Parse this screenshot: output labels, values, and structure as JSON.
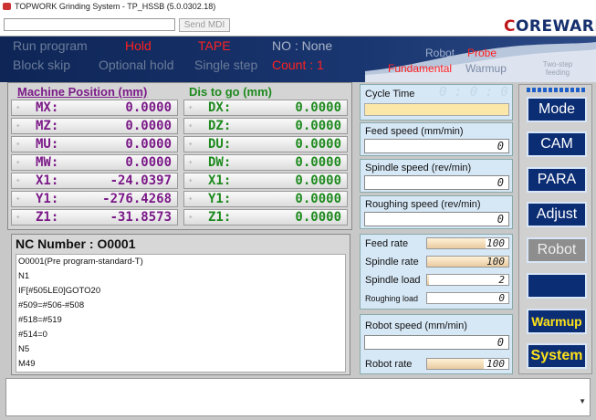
{
  "window": {
    "title": "TOPWORK Grinding System - TP_HSSB (5.0.0302.18)"
  },
  "toolbar": {
    "mdi_value": "",
    "send_mdi": "Send MDI",
    "logo_prefix": "C",
    "logo_rest": "OREWARE"
  },
  "status": {
    "run_program": "Run program",
    "hold": "Hold",
    "tape": "TAPE",
    "no": "NO : None",
    "block_skip": "Block skip",
    "optional_hold": "Optional hold",
    "single_step": "Single step",
    "count": "Count : 1",
    "robot": "Robot",
    "probe": "Probe",
    "fundamental": "Fundamental",
    "warmup": "Warmup",
    "two_step": "Two-step feeding"
  },
  "machine": {
    "title": "Machine Position (mm)",
    "dis_title": "Dis to go  (mm)",
    "left": [
      {
        "name": "MX:",
        "value": "0.0000"
      },
      {
        "name": "MZ:",
        "value": "0.0000"
      },
      {
        "name": "MU:",
        "value": "0.0000"
      },
      {
        "name": "MW:",
        "value": "0.0000"
      },
      {
        "name": "X1:",
        "value": "-24.0397"
      },
      {
        "name": "Y1:",
        "value": "-276.4268"
      },
      {
        "name": "Z1:",
        "value": "-31.8573"
      }
    ],
    "right": [
      {
        "name": "DX:",
        "value": "0.0000"
      },
      {
        "name": "DZ:",
        "value": "0.0000"
      },
      {
        "name": "DU:",
        "value": "0.0000"
      },
      {
        "name": "DW:",
        "value": "0.0000"
      },
      {
        "name": "X1:",
        "value": "0.0000"
      },
      {
        "name": "Y1:",
        "value": "0.0000"
      },
      {
        "name": "Z1:",
        "value": "0.0000"
      }
    ]
  },
  "nc": {
    "label": "NC Number :  O0001",
    "lines": [
      "O0001(Pre program-standard-T)",
      "N1",
      "IF[#505LE0]GOTO20",
      "#509=#506-#508",
      "#518=#519",
      "#514=0",
      "N5",
      "M49"
    ]
  },
  "right_panel": {
    "cycle_time": "Cycle Time",
    "cycle_value": "0 : 0 : 0",
    "feed_speed": "Feed speed (mm/min)",
    "feed_value": "0",
    "spindle_speed": "Spindle speed (rev/min)",
    "spindle_value": "0",
    "roughing_speed": "Roughing speed (rev/min)",
    "roughing_value": "0",
    "feed_rate": "Feed rate",
    "feed_rate_value": "100",
    "feed_rate_pct": 72,
    "spindle_rate": "Spindle rate",
    "spindle_rate_value": "100",
    "spindle_rate_pct": 100,
    "spindle_load": "Spindle load",
    "spindle_load_value": "2",
    "spindle_load_pct": 2,
    "roughing_load": "Roughing load",
    "roughing_load_value": "0",
    "roughing_load_pct": 0,
    "robot_speed": "Robot speed (mm/min)",
    "robot_speed_value": "0",
    "robot_rate": "Robot rate",
    "robot_rate_value": "100",
    "robot_rate_pct": 70
  },
  "side": {
    "buttons": [
      "Mode",
      "CAM",
      "PARA",
      "Adjust",
      "Robot",
      "",
      "Warmup",
      "System"
    ]
  },
  "colors": {
    "accent": "#0b2d74",
    "status_red": "#ff2020",
    "axis_left": "#7b1a88",
    "axis_right": "#1e8a1e"
  }
}
